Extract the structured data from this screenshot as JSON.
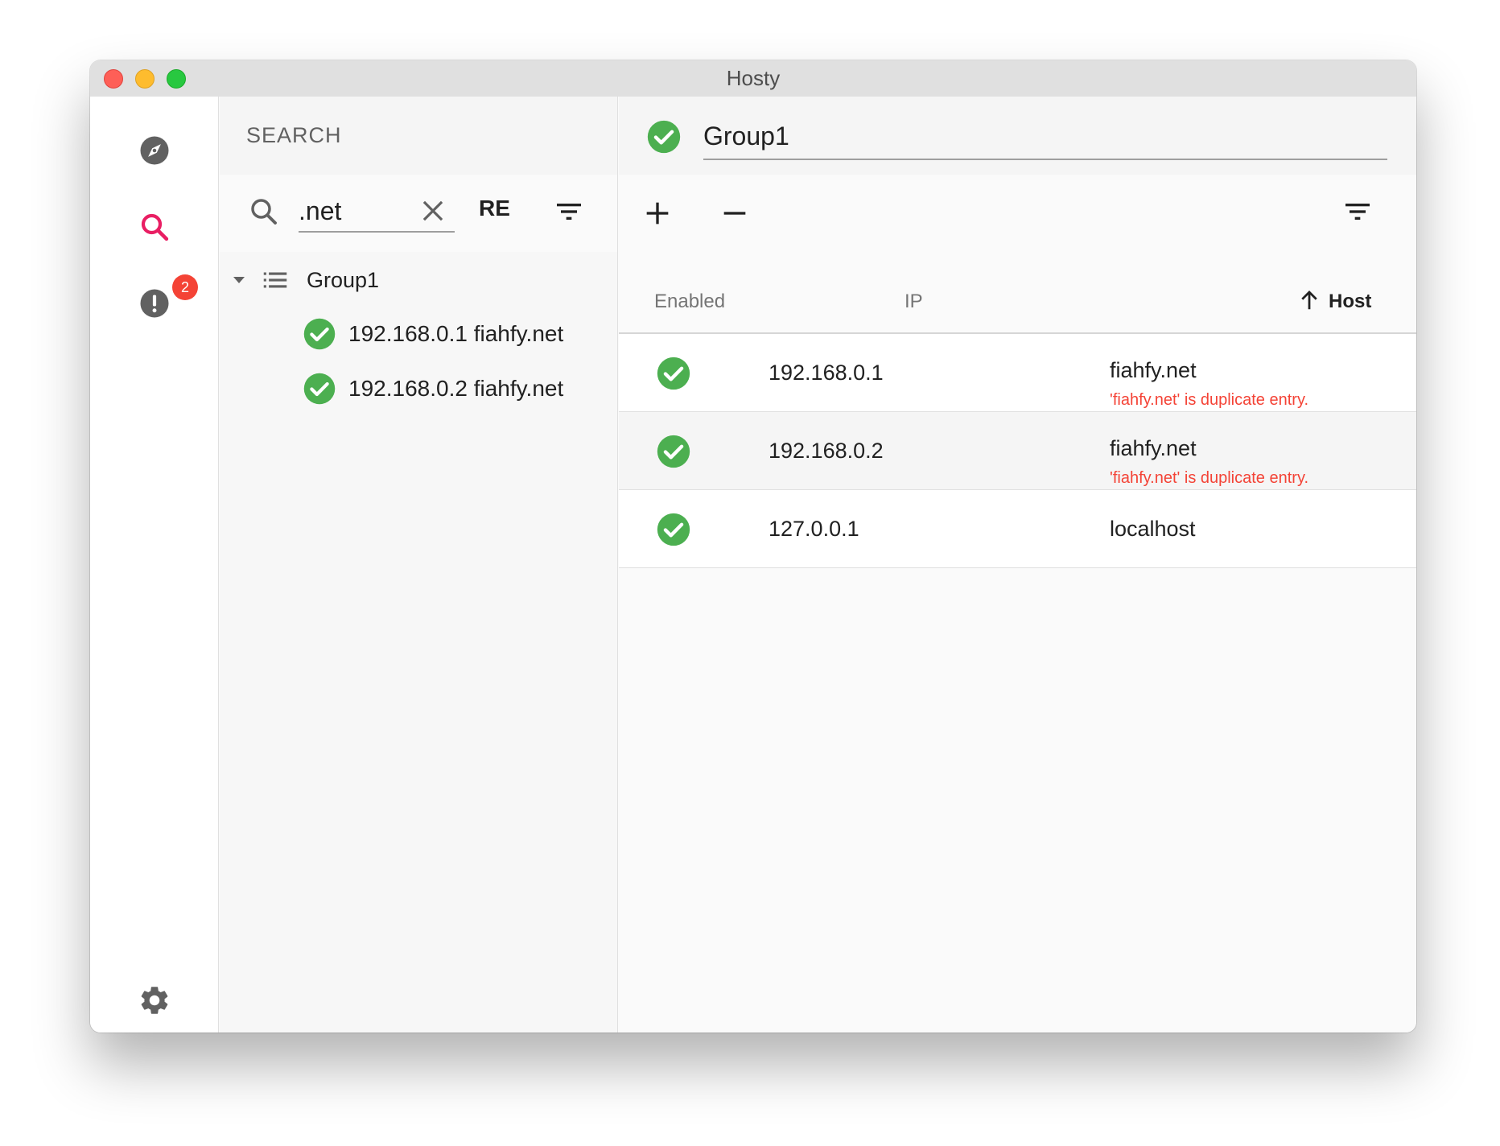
{
  "window": {
    "title": "Hosty"
  },
  "rail": {
    "items": [
      {
        "icon": "compass-icon"
      },
      {
        "icon": "search-icon",
        "active": true
      },
      {
        "icon": "alert-icon",
        "badge": "2"
      },
      {
        "icon": "gear-icon"
      }
    ]
  },
  "search": {
    "header": "SEARCH",
    "query": ".net",
    "regex_label": "RE",
    "tree": {
      "group": "Group1",
      "items": [
        {
          "label": "192.168.0.1 fiahfy.net",
          "enabled": true
        },
        {
          "label": "192.168.0.2 fiahfy.net",
          "enabled": true
        }
      ]
    }
  },
  "main": {
    "group_name": "Group1",
    "group_enabled": true,
    "columns": {
      "enabled": "Enabled",
      "ip": "IP",
      "host": "Host"
    },
    "sort": {
      "column": "host",
      "direction": "ascending"
    },
    "rows": [
      {
        "enabled": true,
        "ip": "192.168.0.1",
        "host": "fiahfy.net",
        "error": "'fiahfy.net' is duplicate entry."
      },
      {
        "enabled": true,
        "ip": "192.168.0.2",
        "host": "fiahfy.net",
        "error": "'fiahfy.net' is duplicate entry."
      },
      {
        "enabled": true,
        "ip": "127.0.0.1",
        "host": "localhost",
        "error": ""
      }
    ]
  },
  "colors": {
    "accent": "#e91e63",
    "success": "#4caf50",
    "error": "#f44336",
    "badge": "#f44336",
    "icon": "#616161"
  }
}
